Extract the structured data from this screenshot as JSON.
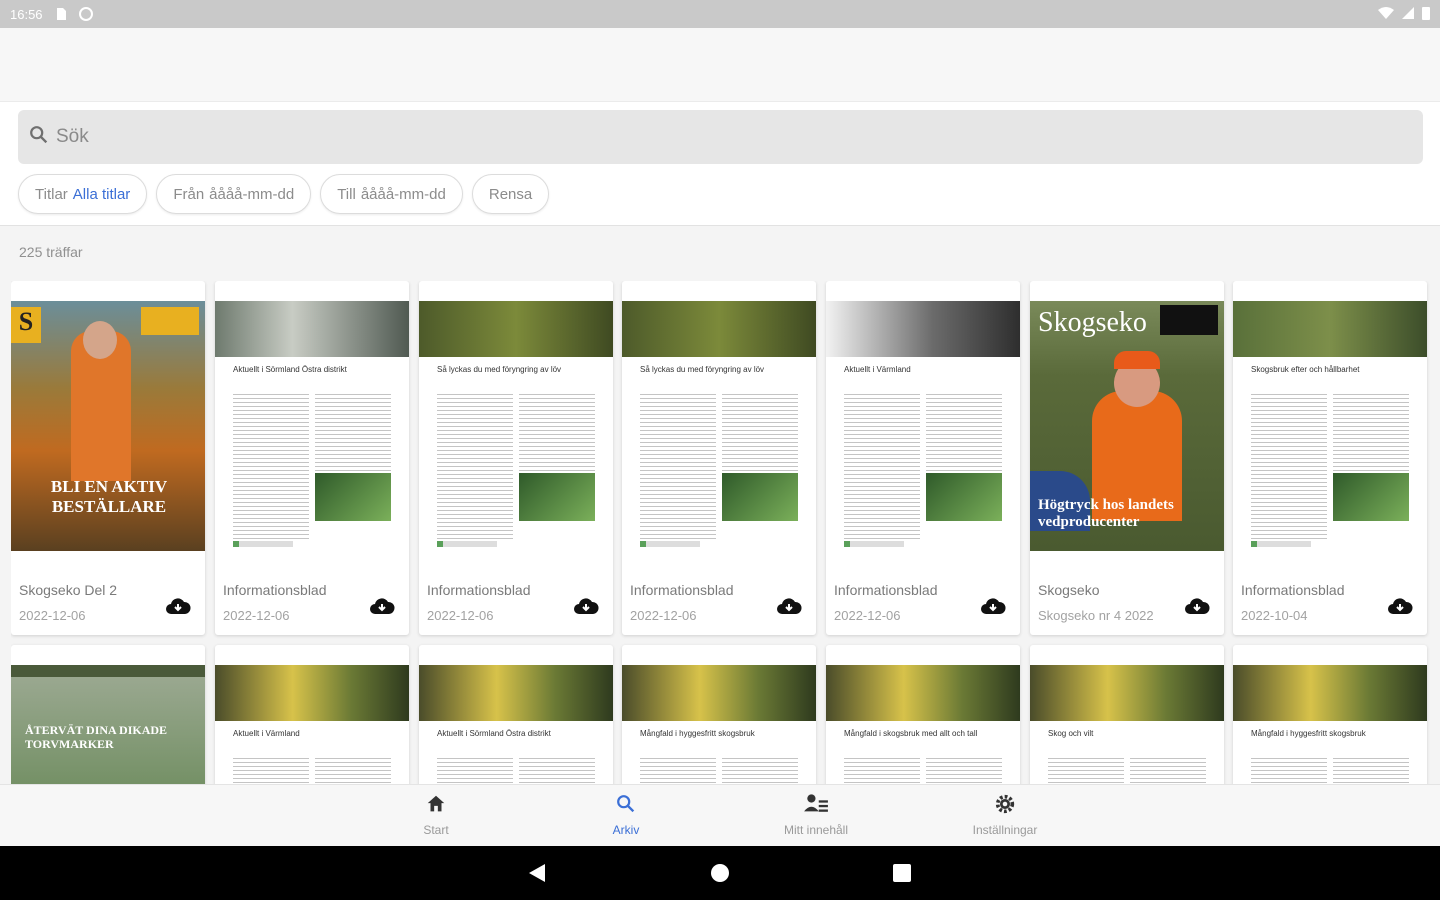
{
  "status_bar": {
    "time": "16:56"
  },
  "search": {
    "placeholder": "Sök"
  },
  "filters": [
    {
      "label": "Titlar",
      "value": "Alla titlar"
    },
    {
      "label": "Från",
      "value": "åååå-mm-dd"
    },
    {
      "label": "Till",
      "value": "åååå-mm-dd"
    },
    {
      "label": "Rensa",
      "value": ""
    }
  ],
  "results_count": "225 träffar",
  "cards": [
    {
      "title": "Skogseko Del 2",
      "subtitle": "2022-12-06",
      "kind": "cover-orange",
      "cover_text": "BLI EN AKTIV BESTÄLLARE"
    },
    {
      "title": "Informationsblad",
      "subtitle": "2022-12-06",
      "kind": "doc",
      "doc_heading": "Aktuellt i Sörmland Östra distrikt"
    },
    {
      "title": "Informationsblad",
      "subtitle": "2022-12-06",
      "kind": "doc",
      "doc_heading": "Så lyckas du med föryngring av löv"
    },
    {
      "title": "Informationsblad",
      "subtitle": "2022-12-06",
      "kind": "doc",
      "doc_heading": "Så lyckas du med föryngring av löv"
    },
    {
      "title": "Informationsblad",
      "subtitle": "2022-12-06",
      "kind": "doc",
      "doc_heading": "Aktuellt i Värmland"
    },
    {
      "title": "Skogseko",
      "subtitle": "Skogseko nr 4 2022",
      "kind": "cover-skogseko",
      "cover_text": "Högtryck hos landets vedproducenter",
      "cover_brand": "Skogseko"
    },
    {
      "title": "Informationsblad",
      "subtitle": "2022-10-04",
      "kind": "doc",
      "doc_heading": "Skogsbruk efter och hållbarhet"
    }
  ],
  "cards_row2": [
    {
      "kind": "cover-green",
      "cover_text": "ÅTERVÄT DINA DIKADE TORVMARKER"
    },
    {
      "kind": "doc",
      "doc_heading": "Aktuellt i Värmland"
    },
    {
      "kind": "doc",
      "doc_heading": "Aktuellt i Sörmland Östra distrikt"
    },
    {
      "kind": "doc",
      "doc_heading": "Mångfald i hyggesfritt skogsbruk"
    },
    {
      "kind": "doc",
      "doc_heading": "Mångfald i skogsbruk med allt och tall"
    },
    {
      "kind": "doc",
      "doc_heading": "Skog och vilt"
    },
    {
      "kind": "doc",
      "doc_heading": "Mångfald i hyggesfritt skogsbruk"
    }
  ],
  "bottom_nav": [
    {
      "label": "Start",
      "icon": "home-icon",
      "active": false
    },
    {
      "label": "Arkiv",
      "icon": "search-icon",
      "active": true
    },
    {
      "label": "Mitt innehåll",
      "icon": "person-list-icon",
      "active": false
    },
    {
      "label": "Inställningar",
      "icon": "gear-icon",
      "active": false
    }
  ],
  "colors": {
    "accent": "#3b6fd6",
    "download_icon": "#111111"
  }
}
